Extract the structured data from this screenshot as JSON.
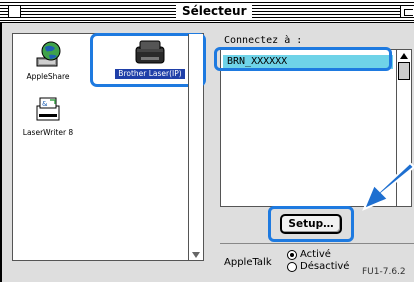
{
  "window": {
    "title": "Sélecteur"
  },
  "chooser": {
    "items": [
      {
        "label": "AppleShare",
        "icon": "appleshare-globe-icon"
      },
      {
        "label": "Brother Laser(IP)",
        "icon": "brother-printer-icon",
        "selected": true
      },
      {
        "label": "LaserWriter 8",
        "icon": "laserwriter-printer-icon"
      }
    ]
  },
  "ports": {
    "label": "Connectez à :",
    "items": [
      {
        "label": "BRN_XXXXXX",
        "selected": true
      }
    ]
  },
  "setup": {
    "label": "Setup…"
  },
  "appletalk": {
    "label": "AppleTalk",
    "options": [
      {
        "label": "Activé",
        "selected": true
      },
      {
        "label": "Désactivé",
        "selected": false
      }
    ]
  },
  "caption": "FU1-7.6.2",
  "colors": {
    "highlight": "#1e7ae0",
    "selection": "#6fd3e8",
    "item_selection": "#1f3fa8",
    "arrow": "#1e6fd0"
  }
}
